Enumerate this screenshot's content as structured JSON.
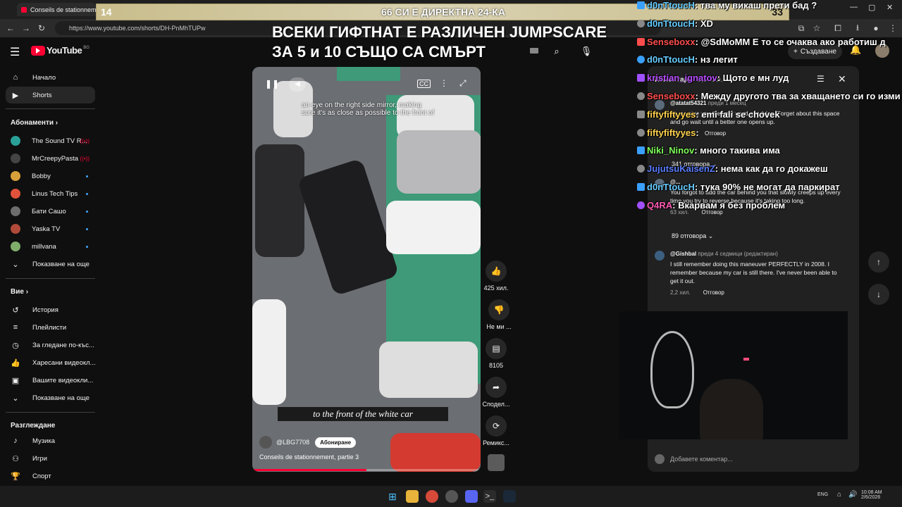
{
  "browser": {
    "tab_title": "Conseils de stationnement",
    "url": "https://www.youtube.com/shorts/DH-PnMhTUPw"
  },
  "overlay": {
    "banner_left": "14",
    "banner_center": "66 СИ Е ДИРЕКТНА 24-КА",
    "banner_right": "33",
    "line1": "ВСЕКИ ГИФТНАТ Е РАЗЛИЧЕН JUMPSCARE",
    "line2": "ЗА 5 и 10 СЪЩО СА СМЪРТ"
  },
  "header": {
    "logo_text": "YouTube",
    "country": "BG",
    "create_label": "Създаване"
  },
  "sidebar": {
    "main": [
      {
        "label": "Начало",
        "icon": "home-icon"
      },
      {
        "label": "Shorts",
        "icon": "shorts-icon"
      }
    ],
    "subscriptions_title": "Абонаменти",
    "subscriptions": [
      {
        "label": "The Sound TV R...",
        "color": "#2aa198",
        "state": "live"
      },
      {
        "label": "MrCreepyPasta",
        "color": "#444444",
        "state": "live"
      },
      {
        "label": "Bobby",
        "color": "#d8a03a",
        "state": "dot"
      },
      {
        "label": "Linus Tech Tips",
        "color": "#e0523b",
        "state": "dot"
      },
      {
        "label": "Бати Сашо",
        "color": "#6d6d6d",
        "state": "dot"
      },
      {
        "label": "Yaska TV",
        "color": "#b04a3a",
        "state": "dot"
      },
      {
        "label": "millvana",
        "color": "#7fae6a",
        "state": "dot"
      }
    ],
    "show_more_subs": "Показване на още",
    "you_title": "Вие",
    "you": [
      {
        "label": "История",
        "icon": "history-icon"
      },
      {
        "label": "Плейлисти",
        "icon": "playlist-icon"
      },
      {
        "label": "За гледане по-къс...",
        "icon": "clock-icon"
      },
      {
        "label": "Харесани видеокл...",
        "icon": "thumbs-up-icon"
      },
      {
        "label": "Вашите видеокли...",
        "icon": "video-icon"
      }
    ],
    "show_more_you": "Показване на още",
    "explore_title": "Разглеждане",
    "explore": [
      {
        "label": "Музика",
        "icon": "music-icon"
      },
      {
        "label": "Игри",
        "icon": "gamepad-icon"
      },
      {
        "label": "Спорт",
        "icon": "trophy-icon"
      }
    ]
  },
  "video": {
    "caption_top": "an eye on the right side mirror, making sure it's as close as possible to the front of",
    "caption_main": "to the front of the white car",
    "channel": "@LBG7708",
    "subscribe_label": "Абониране",
    "title": "Conseils de stationnement, partie 3",
    "progress": 0.5
  },
  "actions": {
    "likes": "425 хил.",
    "dislike": "Не ми ...",
    "comments": "8105",
    "share": "Сподел...",
    "remix": "Ремикс..."
  },
  "comments": {
    "title": "Коментари",
    "count": "8,1 хил.",
    "items": [
      {
        "user": "@atatat54321",
        "time": "преди 1 месец",
        "text": "let me give you the best word of advice. Forget about this space and go wait until a better one opens up.",
        "likes": "121 хил.",
        "reply": "Отговор"
      },
      {
        "user": "@...",
        "time": "",
        "text": "You forgot to add the car behind you that slowly creeps up every time you try to reverse because it's taking too long.",
        "likes": "63 хил.",
        "reply": "Отговор"
      },
      {
        "user": "@Gishbal",
        "time": "преди 4 седмици (редактиран)",
        "text": "I still remember doing this maneuver PERFECTLY in 2008. I remember because my car is still there. I've never been able to get it out.",
        "likes": "2,2 хил.",
        "reply": "Отговор"
      }
    ],
    "replies_1": "341 отговора",
    "replies_2": "89 отговора",
    "add_comment": "Добавете коментар..."
  },
  "chat": [
    {
      "user": "d0nTtoucH",
      "msg": ": тва му викаш прети бад ?",
      "color": "#66ccff"
    },
    {
      "user": "d0nTtoucH",
      "msg": ": XD",
      "color": "#66ccff"
    },
    {
      "user": "Senseboxx",
      "msg": ": @SdMoMM Е то се очаква ако работиш д",
      "color": "#ff4d4d"
    },
    {
      "user": "d0nTtoucH",
      "msg": ": нз легит",
      "color": "#66ccff"
    },
    {
      "user": "kristian_ignatov",
      "msg": ": Щото е мн луд",
      "color": "#b84dff"
    },
    {
      "user": "Senseboxx",
      "msg": ": Между другото тва за хващането си го изми",
      "color": "#ff4d4d"
    },
    {
      "user": "fiftyfiftyyes",
      "msg": ": emi fali se chovek",
      "color": "#ffd24d"
    },
    {
      "user": "fiftyfiftyyes",
      "msg": ":",
      "color": "#ffd24d"
    },
    {
      "user": "Niki_Ninov",
      "msg": ": много такива има",
      "color": "#7fff5a"
    },
    {
      "user": "JujutsuKaisenZ",
      "msg": ": нема как да го докажеш",
      "color": "#5a7dff"
    },
    {
      "user": "d0nTtoucH",
      "msg": ": тука 90% не могат да паркират",
      "color": "#66ccff"
    },
    {
      "user": "Q4RA",
      "msg": ": Вкарвам я без проблем",
      "color": "#ff5ab4"
    }
  ],
  "taskbar": {
    "lang": "ENG",
    "time": "10:08 AM",
    "date": "2/6/2026"
  }
}
